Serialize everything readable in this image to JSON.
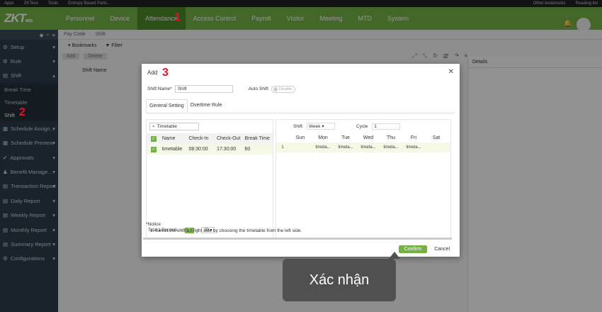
{
  "bookmarks": {
    "items": [
      "Apps",
      "ZKTeco",
      "Tools",
      "Entropy Based Parki..."
    ],
    "other": "Other bookmarks",
    "reading": "Reading list"
  },
  "brand": {
    "logo": "ZKT",
    "logo_suffix": "eco"
  },
  "nav": [
    "Personnel",
    "Device",
    "Attendance",
    "Access Control",
    "Payroll",
    "Visitor",
    "Meeting",
    "MTD",
    "System"
  ],
  "sidebar": {
    "setup": "Setup",
    "rule": "Rule",
    "shift": "Shift",
    "subs": [
      "Break Time",
      "Timetable",
      "Shift"
    ],
    "rest": [
      "Schedule Assign...",
      "Schedule Preview",
      "Approvals",
      "Benefit Manage...",
      "Transaction Report",
      "Daily Report",
      "Weekly Report",
      "Monthly Report",
      "Summary Report",
      "Configurations"
    ]
  },
  "main": {
    "tabs": [
      "Pay Code",
      "Shift"
    ],
    "toolbar": {
      "bookmarks": "Bookmarks",
      "filter": "Filter"
    },
    "actions": {
      "add": "Add",
      "delete": "Delete"
    },
    "col_header": "Shift Name",
    "details": "Details"
  },
  "modal": {
    "title": "Add",
    "shift_name_label": "Shift Name*",
    "shift_name_value": "Shift",
    "auto_shift_label": "Auto Shift",
    "auto_shift_toggle": "Disable",
    "tabs": [
      "General Setting",
      "Overtime Rule"
    ],
    "left": {
      "search_placeholder": "Timetable",
      "headers": [
        "Name",
        "Check-In",
        "Check-Out",
        "Break Time"
      ],
      "rows": [
        [
          "timetable",
          "08:30:00",
          "17:30:00",
          "60"
        ]
      ],
      "total": "Total 1 Records",
      "page": "1",
      "page_size": "20"
    },
    "right": {
      "shift_label": "Shift",
      "shift_value": "Week",
      "cycle_label": "Cycle",
      "cycle_value": "1",
      "days": [
        "Sun",
        "Mon",
        "Tue",
        "Wed",
        "Thu",
        "Fri",
        "Sat"
      ],
      "row": [
        "1",
        "",
        "timeta...",
        "timeta...",
        "timeta...",
        "timeta...",
        "timeta...",
        ""
      ]
    },
    "notice_title": "*Notice",
    "notice_text": "1. Select the shift on right side by choosing the timetable from the left side.",
    "confirm": "Confirm",
    "cancel": "Cancel"
  },
  "annotations": {
    "n1": "1",
    "n2": "2",
    "n3": "3"
  },
  "tooltip": "Xác nhận"
}
